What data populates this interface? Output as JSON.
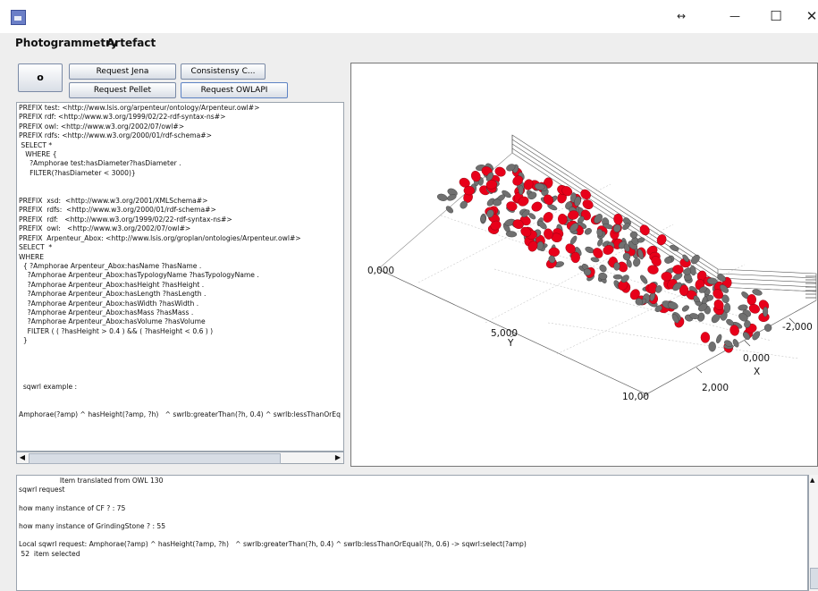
{
  "window": {
    "resize_glyph": "↔",
    "minimize_glyph": "—",
    "maximize_glyph": "☐",
    "close_glyph": "✕"
  },
  "menu": [
    "Photogrammetry",
    "Artefact"
  ],
  "toolbar": {
    "o_label": "o",
    "request_jena": "Request Jena",
    "consistency": "Consistensy C...",
    "request_pellet": "Request Pellet",
    "request_owlapi": "Request OWLAPI"
  },
  "query_text": "PREFIX test: <http://www.lsis.org/arpenteur/ontology/Arpenteur.owl#>\nPREFIX rdf: <http://www.w3.org/1999/02/22-rdf-syntax-ns#>\nPREFIX owl: <http://www.w3.org/2002/07/owl#>\nPREFIX rdfs: <http://www.w3.org/2000/01/rdf-schema#>\n SELECT *\n   WHERE {\n     ?Amphorae test:hasDiameter?hasDiameter .\n     FILTER(?hasDiameter < 3000)}\n\n\nPREFIX  xsd:  <http://www.w3.org/2001/XMLSchema#>\nPREFIX  rdfs:  <http://www.w3.org/2000/01/rdf-schema#>\nPREFIX  rdf:   <http://www.w3.org/1999/02/22-rdf-syntax-ns#>\nPREFIX  owl:   <http://www.w3.org/2002/07/owl#>\nPREFIX  Arpenteur_Abox: <http://www.lsis.org/groplan/ontologies/Arpenteur.owl#>\nSELECT  *\nWHERE\n  { ?Amphorae Arpenteur_Abox:hasName ?hasName .\n    ?Amphorae Arpenteur_Abox:hasTypologyName ?hasTypologyName .\n    ?Amphorae Arpenteur_Abox:hasHeight ?hasHeight .\n    ?Amphorae Arpenteur_Abox:hasLength ?hasLength .\n    ?Amphorae Arpenteur_Abox:hasWidth ?hasWidth .\n    ?Amphorae Arpenteur_Abox:hasMass ?hasMass .\n    ?Amphorae Arpenteur_Abox:hasVolume ?hasVolume\n    FILTER ( ( ?hasHeight > 0.4 ) && ( ?hasHeight < 0.6 ) )\n  }\n\n\n\n\n  sqwrl example :\n\n\nAmphorae(?amp) ^ hasHeight(?amp, ?h)   ^ swrlb:greaterThan(?h, 0.4) ^ swrlb:lessThanOrEq",
  "console_text": "                   Item translated from OWL 130\nsqwrl request\n\nhow many instance of CF ? : 75\n\nhow many instance of GrindingStone ? : 55\n\nLocal sqwrl request: Amphorae(?amp) ^ hasHeight(?amp, ?h)   ^ swrlb:greaterThan(?h, 0.4) ^ swrlb:lessThanOrEqual(?h, 0.6) -> sqwrl:select(?amp)\n 52  item selected",
  "plot": {
    "labels": {
      "origin_y": "0,000",
      "y5": "5,000",
      "y_axis": "Y",
      "y10": "10,00",
      "x2": "2,000",
      "x0": "0,000",
      "x_axis": "X",
      "xm2": "-2,000"
    },
    "colors": {
      "highlight": "#e8001a",
      "other": "#707070"
    }
  }
}
